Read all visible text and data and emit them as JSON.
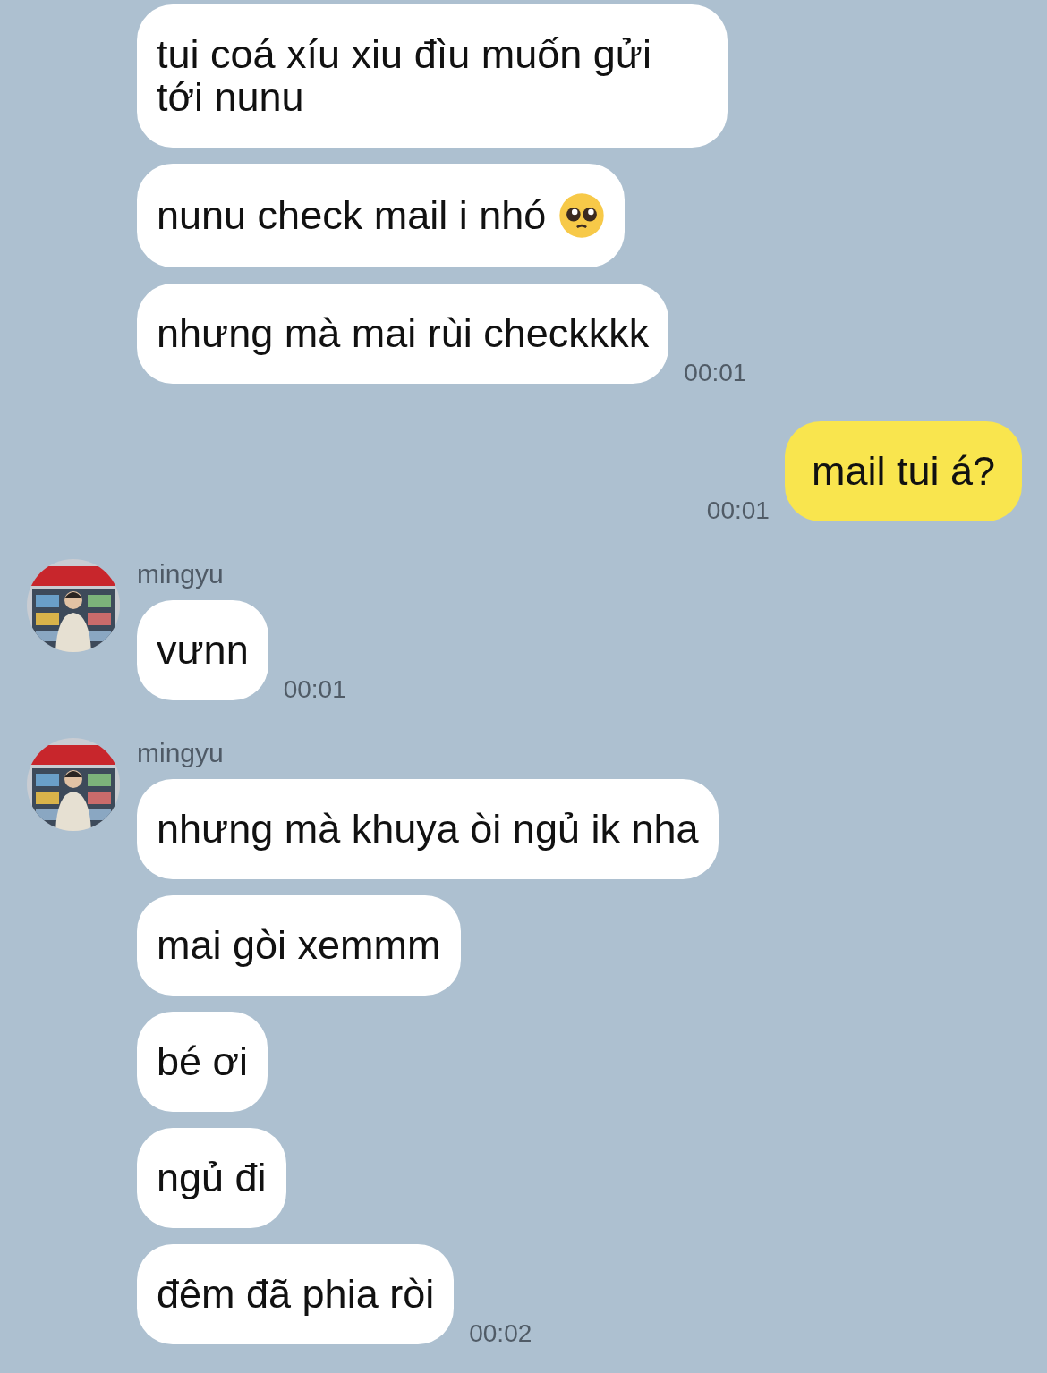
{
  "groups": [
    {
      "kind": "incoming",
      "show_avatar": false,
      "messages": [
        {
          "text": "tui coá xíu xiu đìu muốn gửi tới nunu",
          "has_emoji": false
        },
        {
          "text": "nunu check mail i nhó",
          "has_emoji": true
        },
        {
          "text": "nhưng mà mai rùi checkkkk",
          "has_emoji": false
        }
      ],
      "time": "00:01"
    },
    {
      "kind": "outgoing",
      "show_avatar": false,
      "messages": [
        {
          "text": "mail tui á?",
          "has_emoji": false
        }
      ],
      "time": "00:01"
    },
    {
      "kind": "incoming",
      "show_avatar": true,
      "name": "mingyu",
      "messages": [
        {
          "text": "vưnn",
          "has_emoji": false
        }
      ],
      "time": "00:01"
    },
    {
      "kind": "incoming",
      "show_avatar": true,
      "name": "mingyu",
      "messages": [
        {
          "text": "nhưng mà khuya òi ngủ ik nha",
          "has_emoji": false
        },
        {
          "text": "mai gòi xemmm",
          "has_emoji": false
        },
        {
          "text": "bé ơi",
          "has_emoji": false
        },
        {
          "text": "ngủ đi",
          "has_emoji": false
        },
        {
          "text": "đêm đã phia ròi",
          "has_emoji": false
        }
      ],
      "time": "00:02"
    }
  ]
}
